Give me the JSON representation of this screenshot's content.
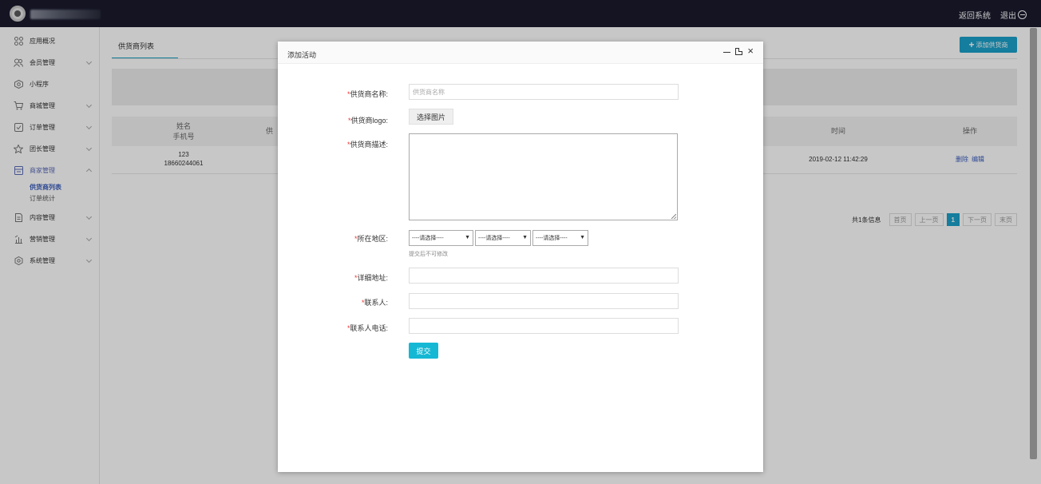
{
  "topbar": {
    "back_label": "返回系统",
    "logout_label": "退出"
  },
  "sidebar": {
    "items": [
      {
        "label": "应用概况",
        "icon": "apps-icon"
      },
      {
        "label": "会员管理",
        "icon": "members-icon"
      },
      {
        "label": "小程序",
        "icon": "miniprogram-icon"
      },
      {
        "label": "商城管理",
        "icon": "cart-icon"
      },
      {
        "label": "订单管理",
        "icon": "order-icon"
      },
      {
        "label": "团长管理",
        "icon": "leader-icon"
      },
      {
        "label": "商家管理",
        "icon": "merchant-icon"
      },
      {
        "label": "内容管理",
        "icon": "content-icon"
      },
      {
        "label": "营销管理",
        "icon": "marketing-icon"
      },
      {
        "label": "系统管理",
        "icon": "settings-icon"
      }
    ],
    "sub_items": [
      "供货商列表",
      "订单统计"
    ]
  },
  "main": {
    "tab_label": "供货商列表",
    "add_button": "添加供货商",
    "table": {
      "headers": {
        "name": "姓名",
        "phone": "手机号",
        "supplier": "供",
        "time": "时间",
        "ops": "操作"
      },
      "rows": [
        {
          "name": "123",
          "phone": "18660244061",
          "time": "2019-02-12 11:42:29",
          "op_delete": "删除",
          "op_edit": "编辑"
        }
      ]
    },
    "pagination": {
      "total": "共1条信息",
      "first": "首页",
      "prev": "上一页",
      "current": "1",
      "next": "下一页",
      "last": "末页"
    }
  },
  "modal": {
    "title": "添加活动",
    "fields": {
      "name_label": "供货商名称:",
      "name_placeholder": "供货商名称",
      "logo_label": "供货商logo:",
      "logo_button": "选择图片",
      "desc_label": "供货商描述:",
      "region_label": "所在地区:",
      "region_select_1": "----请选择----",
      "region_select_2": "----请选择----",
      "region_select_3": "----请选择----",
      "region_hint": "提交后不可修改",
      "address_label": "详细地址:",
      "contact_label": "联系人:",
      "phone_label": "联系人电话:"
    },
    "submit": "提交"
  },
  "colors": {
    "accent": "#1ba1c9",
    "topbar": "#1a1a2e",
    "required": "#e33333",
    "link": "#3a5dbd"
  }
}
